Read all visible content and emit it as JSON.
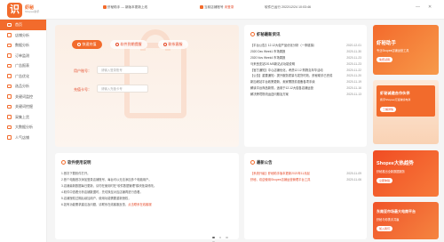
{
  "app": {
    "logo_char": "识",
    "name": "虾秘",
    "sub": "Shopee助手"
  },
  "topbar": {
    "notice1": "虾秘助手 — 新版本更新上线",
    "shop": "当前店铺账号",
    "shop_status": "未登录",
    "time_label": "软件已运行",
    "time_value": "2022/12/24 10:03:46"
  },
  "sidebar": {
    "items": [
      {
        "label": "首页",
        "active": true
      },
      {
        "label": "店铺分析"
      },
      {
        "label": "数据分析"
      },
      {
        "label": "订单监测"
      },
      {
        "label": "广告报表"
      },
      {
        "label": "广告优化"
      },
      {
        "label": "选品分析"
      },
      {
        "label": "关键词监控"
      },
      {
        "label": "关键词挖掘"
      },
      {
        "label": "采集上货"
      },
      {
        "label": "大数据分析"
      },
      {
        "label": "人气店铺"
      }
    ]
  },
  "hero": {
    "tabs": [
      "快速充值",
      "软件到期提醒",
      "联系客服"
    ],
    "account_label": "用户账号：",
    "account_placeholder": "请输入登录账号",
    "code_label": "充值卡号：",
    "code_placeholder": "请输入充值卡号"
  },
  "news": {
    "title": "虾秘最新资讯",
    "items": [
      {
        "title": "【平台公告】12.12大促产品优化分析（一条链接）",
        "date": "2020-12-01"
      },
      {
        "title": "2020 Dec Week1 市场周报",
        "date": "2020-11-30"
      },
      {
        "title": "2020 Nov Week4 市场周报",
        "date": "2020-11-23"
      },
      {
        "title": "马来西亚站DS.MS新站点功能说明",
        "date": "2020-11-23"
      },
      {
        "title": "【官方通知】中心店铺优化，考虑12.12 购物嘉年华活动",
        "date": "2020-11-22"
      },
      {
        "title": "【公告】重要通知：提升服务质量与发货时效，虾秘助手已完成",
        "date": "2020-11-20"
      },
      {
        "title": "新加坡站平台政策更新，卖家需提前准备各项手续",
        "date": "2020-11-19"
      },
      {
        "title": "解读平台商品新规，适用于12.12大促各店铺运营",
        "date": "2020-11-16"
      },
      {
        "title": "解决跨境物流运送问题及方案",
        "date": "2020-11-13"
      }
    ]
  },
  "guide": {
    "title": "软件使用说明",
    "lines": [
      {
        "text": "1.首次下载软件打开。",
        "hl": ""
      },
      {
        "text": "2.首个电脑首次添加登录店铺账号，每台可以无法添加多个电脑用户。",
        "hl": ""
      },
      {
        "text": "3.店铺最新数据每日更新，请勿在使用时在“软件数据管理”模块批量修改。",
        "hl": ""
      },
      {
        "text": "4.软件中查看分析店铺数据时，先切换至对应店铺再进行查看。",
        "hl": ""
      },
      {
        "text": "5.店铺授权过期后续加用户，使用功能需要重新授权，",
        "hl": ""
      },
      {
        "text": "6.如有功能需求建议及问题，请联系在线客服反馈，",
        "hl": "点击联系在线客服"
      }
    ]
  },
  "notice": {
    "title": "最新公告",
    "items": [
      {
        "title": "【系统升级】虾秘助手版本更新2020年11月起",
        "date": "2020-11-09"
      },
      {
        "title": "虾秘，欢迎使用Shopee店铺运营管理平台工具",
        "date": "2020-11-06"
      }
    ]
  },
  "banners": {
    "b1": {
      "title": "虾秘助手",
      "sub": "专业Shopee店铺运营工具",
      "pill": "免费试用"
    },
    "b2": {
      "title": "虾秘诚邀合作伙伴",
      "sub": "携手Shopee打造跨境电商",
      "pill": "了解详情"
    },
    "b3": {
      "title": "Shopee大热趋势",
      "sub": "虾秘推出全新数据服务",
      "pill": "立即体验"
    },
    "b4": {
      "title": "东南亚市场最大电商平台",
      "sub": "虾秘与你携手共赢",
      "pill": "加入我们"
    }
  },
  "pager": {
    "count": 4,
    "active": 0
  },
  "colors": {
    "accent": "#f26b2c",
    "accent_red": "#e54a2a"
  }
}
